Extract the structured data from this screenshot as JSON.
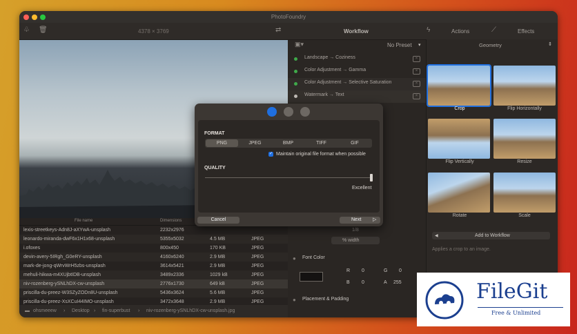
{
  "window": {
    "title": "PhotoFoundry"
  },
  "toolbar": {
    "resolution": "4378 × 3769",
    "workflow": "Workflow",
    "actions": "Actions",
    "effects": "Effects"
  },
  "workflow": {
    "preset": "No Preset",
    "items": [
      {
        "label": "Landscape → Coziness",
        "active": true
      },
      {
        "label": "Color Adjustment → Gamma",
        "active": true
      },
      {
        "label": "Color Adjustment → Selective Saturation",
        "active": true
      },
      {
        "label": "Watermark → Text",
        "active": false
      }
    ]
  },
  "effects": {
    "category": "Geometry",
    "items": [
      {
        "label": "Crop"
      },
      {
        "label": "Flip Horizontally"
      },
      {
        "label": "Flip Vertically"
      },
      {
        "label": "Resize"
      },
      {
        "label": "Rotate"
      },
      {
        "label": "Scale"
      }
    ],
    "add_button": "Add to Workflow",
    "description": "Applies a crop to an image."
  },
  "files": {
    "headers": [
      "File name",
      "Dimensions",
      "",
      ""
    ],
    "rows": [
      {
        "name": "lexis-streetkeys-Adn8J-aXYwA-unsplash",
        "dims": "2232x2976",
        "size": "",
        "type": ""
      },
      {
        "name": "leonardo-miranda-dwF6x1H1x68-unsplash",
        "dims": "5355x5032",
        "size": "4.5 MB",
        "type": "JPEG"
      },
      {
        "name": "i.ofoxes",
        "dims": "800x450",
        "size": "170 KB",
        "type": "JPEG"
      },
      {
        "name": "devin-avery-5IRgh_G0eRY-unsplash",
        "dims": "4160x6240",
        "size": "2.9 MB",
        "type": "JPEG"
      },
      {
        "name": "mark-de-jong-qWrvWrH5zbs-unsplash",
        "dims": "3614x5421",
        "size": "2.9 MB",
        "type": "JPEG"
      },
      {
        "name": "mehuli-hikwa-m4XUjbtIDB-unsplash",
        "dims": "3489x2336",
        "size": "1029 kB",
        "type": "JPEG"
      },
      {
        "name": "niv-rozenberg-ySNLhDX-cw-unsplash",
        "dims": "2776x1730",
        "size": "649 kB",
        "type": "JPEG"
      },
      {
        "name": "priscilla-du-preez-W3SZyZODn8U-unsplash",
        "dims": "5436x3624",
        "size": "5.6 MB",
        "type": "JPEG"
      },
      {
        "name": "priscilla-du-preez-XsXCuI44IMO-unsplash",
        "dims": "3472x3648",
        "size": "2.9 MB",
        "type": "JPEG"
      }
    ]
  },
  "pathbar": [
    "ohsmeeew",
    "Desktop",
    "fin-superbust",
    "niv-rozenberg-ySNLhDX-cw-unsplash.jpg"
  ],
  "settings": {
    "ratio": "1/8",
    "width_mode": "% width",
    "font_color": "Font Color",
    "r": "0",
    "g": "0",
    "b": "0",
    "a": "255",
    "r_label": "R",
    "g_label": "G",
    "b_label": "B",
    "a_label": "A",
    "placement": "Placement & Padding"
  },
  "dialog": {
    "format_title": "FORMAT",
    "formats": [
      "PNG",
      "JPEG",
      "BMP",
      "TIFF",
      "GIF"
    ],
    "selected_format": "PNG",
    "maintain_label": "Maintain original file format when possible",
    "maintain_checked": true,
    "quality_title": "QUALITY",
    "quality_value": "Excellent",
    "quality_level": 1.0,
    "cancel": "Cancel",
    "next": "Next"
  },
  "watermark": {
    "brand": "FileGit",
    "tagline": "Free & Unlimited"
  },
  "colors": {
    "accent": "#1f6fe0",
    "active_dot": "#3fa94a",
    "brand_blue": "#1b3f8f"
  }
}
